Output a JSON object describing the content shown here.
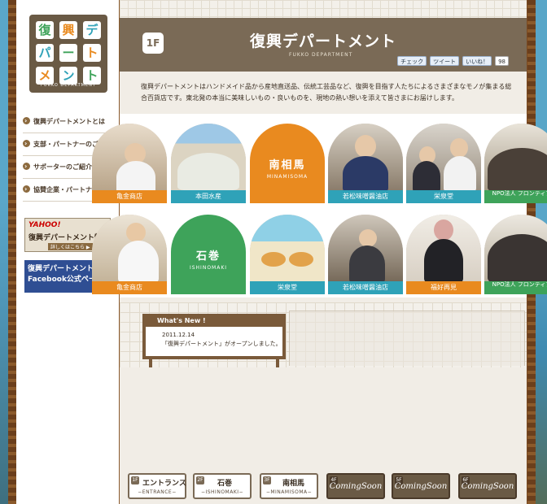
{
  "logo": {
    "chars": [
      "復",
      "興",
      "デ",
      "パ",
      "ー",
      "ト",
      "メ",
      "ン",
      "ト"
    ],
    "caption": "FUKKO DEPARTMENT"
  },
  "sidebar": {
    "items": [
      {
        "label": "復興デパートメントとは"
      },
      {
        "label": "支部・パートナーのご紹介"
      },
      {
        "label": "サポーターのご紹介"
      },
      {
        "label": "協賛企業・パートナー募集"
      }
    ],
    "yahoo_banner": {
      "brand": "YAHOO!",
      "title": "復興デパートメント特集",
      "link": "詳しくはこちら ▶"
    },
    "facebook_banner": {
      "line1": "復興デパートメント",
      "line2": "Facebook公式ページ"
    }
  },
  "header": {
    "floor": "1F",
    "title": "復興デパートメント",
    "subtitle": "FUKKO DEPARTMENT",
    "social": {
      "check": "チェック",
      "tweet": "ツイート",
      "like": "いいね！",
      "like_count": "98"
    }
  },
  "intro": "復興デパートメントはハンドメイド品から産地直送品、伝統工芸品など、復興を目指す人たちによるさまざまなモノが集まる総合百貨店です。東北発の本当に美味しいもの・良いものを、現地の熱い想いを添えて皆さまにお届けします。",
  "gallery": {
    "row1": [
      {
        "label": "亀金商店",
        "color": "#e98a1f"
      },
      {
        "label": "本田水産",
        "color": "#2fa2b8"
      },
      {
        "label": "南相馬",
        "label_en": "MINAMISOMA",
        "color": "#e98a1f",
        "is_area": true
      },
      {
        "label": "若松味噌醤油店",
        "color": "#2fa2b8"
      },
      {
        "label": "栄泉堂",
        "color": "#2fa2b8"
      },
      {
        "label": "NPO法人 フロンティア",
        "color": "#3ea35a"
      }
    ],
    "row2": [
      {
        "label": "亀金商店",
        "color": "#e98a1f"
      },
      {
        "label": "石巻",
        "label_en": "ISHINOMAKI",
        "color": "#3ea35a",
        "is_area": true
      },
      {
        "label": "栄泉堂",
        "color": "#2fa2b8"
      },
      {
        "label": "若松味噌醤油店",
        "color": "#2fa2b8"
      },
      {
        "label": "福好再見",
        "color": "#e98a1f"
      },
      {
        "label": "NPO法人 フロンティア",
        "color": "#3ea35a"
      }
    ]
  },
  "news": {
    "heading": "What's New !",
    "date": "2011.12.14",
    "text": "「復興デパートメント」がオープンしました。"
  },
  "floornav": [
    {
      "num": "1F",
      "jp": "エントランス",
      "en": "−ENTRANCE−"
    },
    {
      "num": "2F",
      "jp": "石巻",
      "en": "−ISHINOMAKI−"
    },
    {
      "num": "3F",
      "jp": "南相馬",
      "en": "−MINAMISOMA−"
    },
    {
      "num": "4F",
      "soon": "ComingSoon"
    },
    {
      "num": "5F",
      "soon": "ComingSoon"
    },
    {
      "num": "6F",
      "soon": "ComingSoon"
    }
  ],
  "colors": {
    "header_bg": "#7a6a56",
    "orange": "#e98a1f",
    "teal": "#2fa2b8",
    "green": "#3ea35a"
  }
}
